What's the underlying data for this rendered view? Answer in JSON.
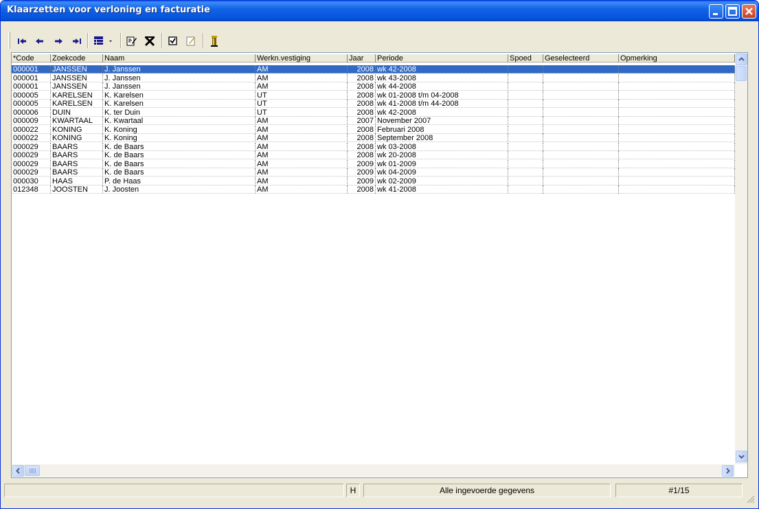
{
  "window": {
    "title": "Klaarzetten voor verloning en facturatie"
  },
  "toolbar": {
    "icons": [
      "first-record-icon",
      "previous-record-icon",
      "next-record-icon",
      "last-record-icon",
      "view-dropdown-icon",
      "edit-record-icon",
      "delete-record-icon",
      "select-checkbox-icon",
      "notes-icon",
      "tools-icon"
    ]
  },
  "table": {
    "columns": [
      "*Code",
      "Zoekcode",
      "Naam",
      "Werkn.vestiging",
      "Jaar",
      "Periode",
      "Spoed",
      "Geselecteerd",
      "Opmerking"
    ],
    "rows": [
      [
        "000001",
        "JANSSEN",
        "J. Janssen",
        "AM",
        "2008",
        "wk 42-2008",
        "",
        "",
        ""
      ],
      [
        "000001",
        "JANSSEN",
        "J. Janssen",
        "AM",
        "2008",
        "wk 43-2008",
        "",
        "",
        ""
      ],
      [
        "000001",
        "JANSSEN",
        "J. Janssen",
        "AM",
        "2008",
        "wk 44-2008",
        "",
        "",
        ""
      ],
      [
        "000005",
        "KARELSEN",
        "K. Karelsen",
        "UT",
        "2008",
        "wk 01-2008 t/m 04-2008",
        "",
        "",
        ""
      ],
      [
        "000005",
        "KARELSEN",
        "K. Karelsen",
        "UT",
        "2008",
        "wk 41-2008 t/m 44-2008",
        "",
        "",
        ""
      ],
      [
        "000006",
        "DUIN",
        "K. ter Duin",
        "UT",
        "2008",
        "wk 42-2008",
        "",
        "",
        ""
      ],
      [
        "000009",
        "KWARTAAL",
        "K. Kwartaal",
        "AM",
        "2007",
        "November 2007",
        "",
        "",
        ""
      ],
      [
        "000022",
        "KONING",
        "K. Koning",
        "AM",
        "2008",
        "Februari 2008",
        "",
        "",
        ""
      ],
      [
        "000022",
        "KONING",
        "K. Koning",
        "AM",
        "2008",
        "September 2008",
        "",
        "",
        ""
      ],
      [
        "000029",
        "BAARS",
        "K. de Baars",
        "AM",
        "2008",
        "wk 03-2008",
        "",
        "",
        ""
      ],
      [
        "000029",
        "BAARS",
        "K. de Baars",
        "AM",
        "2008",
        "wk 20-2008",
        "",
        "",
        ""
      ],
      [
        "000029",
        "BAARS",
        "K. de Baars",
        "AM",
        "2009",
        "wk 01-2009",
        "",
        "",
        ""
      ],
      [
        "000029",
        "BAARS",
        "K. de Baars",
        "AM",
        "2009",
        "wk 04-2009",
        "",
        "",
        ""
      ],
      [
        "000030",
        "HAAS",
        "P. de Haas",
        "AM",
        "2009",
        "wk 02-2009",
        "",
        "",
        ""
      ],
      [
        "012348",
        "JOOSTEN",
        "J. Joosten",
        "AM",
        "2008",
        "wk 41-2008",
        "",
        "",
        ""
      ]
    ],
    "selected_row": 0
  },
  "status": {
    "panel1": "",
    "panel2": "H",
    "panel3": "Alle ingevoerde gegevens",
    "panel4": "#1/15"
  }
}
